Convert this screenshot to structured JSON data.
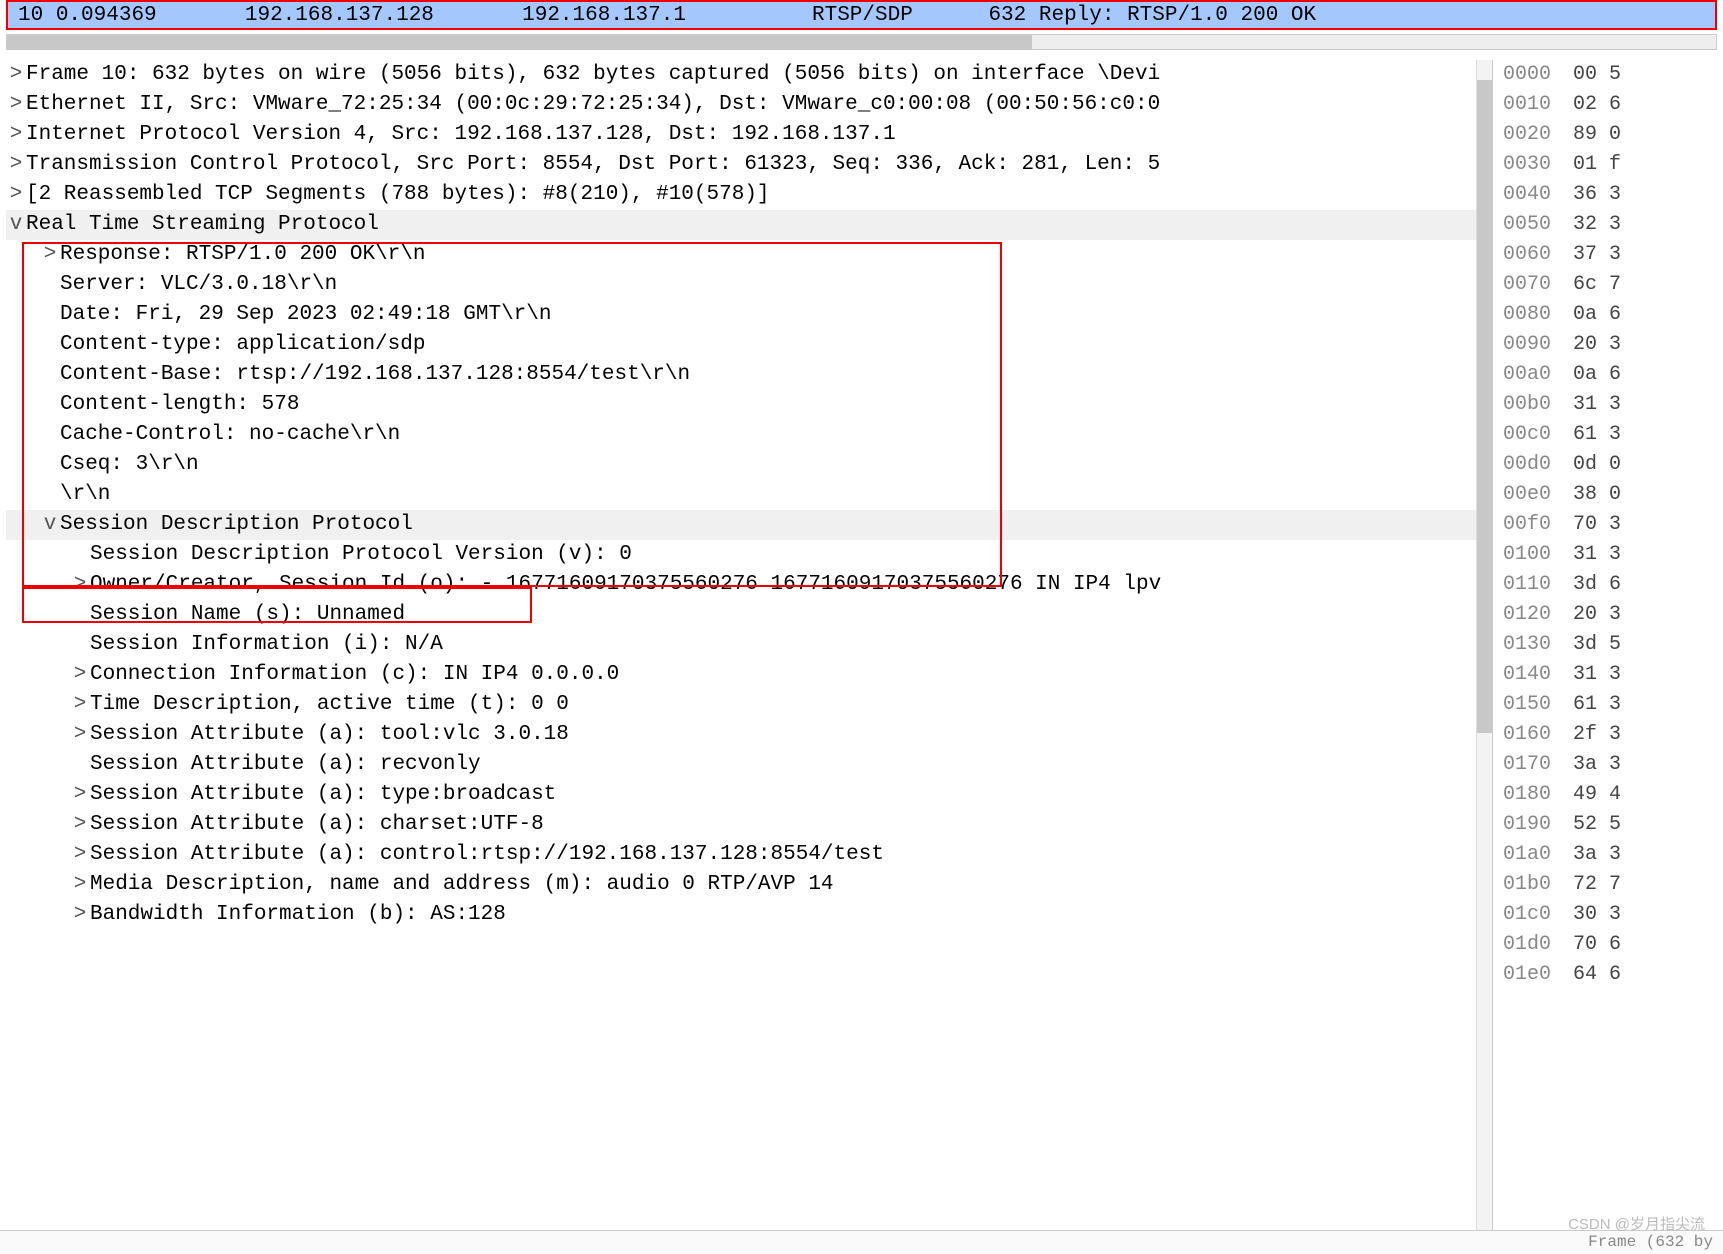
{
  "packet_row": {
    "no": "10",
    "time": "0.094369",
    "src": "192.168.137.128",
    "dst": "192.168.137.1",
    "proto": "RTSP/SDP",
    "len": "632",
    "info": "Reply: RTSP/1.0 200 OK"
  },
  "details": [
    {
      "tw": ">",
      "ind": 0,
      "dim": 0,
      "txt": "Frame 10: 632 bytes on wire (5056 bits), 632 bytes captured (5056 bits) on interface \\Devi"
    },
    {
      "tw": ">",
      "ind": 0,
      "dim": 0,
      "txt": "Ethernet II, Src: VMware_72:25:34 (00:0c:29:72:25:34), Dst: VMware_c0:00:08 (00:50:56:c0:0"
    },
    {
      "tw": ">",
      "ind": 0,
      "dim": 0,
      "txt": "Internet Protocol Version 4, Src: 192.168.137.128, Dst: 192.168.137.1"
    },
    {
      "tw": ">",
      "ind": 0,
      "dim": 0,
      "txt": "Transmission Control Protocol, Src Port: 8554, Dst Port: 61323, Seq: 336, Ack: 281, Len: 5"
    },
    {
      "tw": ">",
      "ind": 0,
      "dim": 0,
      "txt": "[2 Reassembled TCP Segments (788 bytes): #8(210), #10(578)]"
    },
    {
      "tw": "v",
      "ind": 0,
      "dim": 1,
      "txt": "Real Time Streaming Protocol"
    },
    {
      "tw": ">",
      "ind": 1,
      "dim": 0,
      "txt": "Response: RTSP/1.0 200 OK\\r\\n"
    },
    {
      "tw": "",
      "ind": 1,
      "dim": 0,
      "txt": "Server: VLC/3.0.18\\r\\n"
    },
    {
      "tw": "",
      "ind": 1,
      "dim": 0,
      "txt": "Date: Fri, 29 Sep 2023 02:49:18 GMT\\r\\n"
    },
    {
      "tw": "",
      "ind": 1,
      "dim": 0,
      "txt": "Content-type: application/sdp"
    },
    {
      "tw": "",
      "ind": 1,
      "dim": 0,
      "txt": "Content-Base: rtsp://192.168.137.128:8554/test\\r\\n"
    },
    {
      "tw": "",
      "ind": 1,
      "dim": 0,
      "txt": "Content-length: 578"
    },
    {
      "tw": "",
      "ind": 1,
      "dim": 0,
      "txt": "Cache-Control: no-cache\\r\\n"
    },
    {
      "tw": "",
      "ind": 1,
      "dim": 0,
      "txt": "Cseq: 3\\r\\n"
    },
    {
      "tw": "",
      "ind": 1,
      "dim": 0,
      "txt": "\\r\\n"
    },
    {
      "tw": "v",
      "ind": 1,
      "dim": 1,
      "txt": "Session Description Protocol"
    },
    {
      "tw": "",
      "ind": 2,
      "dim": 0,
      "txt": "Session Description Protocol Version (v): 0"
    },
    {
      "tw": ">",
      "ind": 2,
      "dim": 0,
      "txt": "Owner/Creator, Session Id (o): - 16771609170375560276 16771609170375560276 IN IP4 lpv"
    },
    {
      "tw": "",
      "ind": 2,
      "dim": 0,
      "txt": "Session Name (s): Unnamed"
    },
    {
      "tw": "",
      "ind": 2,
      "dim": 0,
      "txt": "Session Information (i): N/A"
    },
    {
      "tw": ">",
      "ind": 2,
      "dim": 0,
      "txt": "Connection Information (c): IN IP4 0.0.0.0"
    },
    {
      "tw": ">",
      "ind": 2,
      "dim": 0,
      "txt": "Time Description, active time (t): 0 0"
    },
    {
      "tw": ">",
      "ind": 2,
      "dim": 0,
      "txt": "Session Attribute (a): tool:vlc 3.0.18"
    },
    {
      "tw": "",
      "ind": 2,
      "dim": 0,
      "txt": "Session Attribute (a): recvonly"
    },
    {
      "tw": ">",
      "ind": 2,
      "dim": 0,
      "txt": "Session Attribute (a): type:broadcast"
    },
    {
      "tw": ">",
      "ind": 2,
      "dim": 0,
      "txt": "Session Attribute (a): charset:UTF-8"
    },
    {
      "tw": ">",
      "ind": 2,
      "dim": 0,
      "txt": "Session Attribute (a): control:rtsp://192.168.137.128:8554/test"
    },
    {
      "tw": ">",
      "ind": 2,
      "dim": 0,
      "txt": "Media Description, name and address (m): audio 0 RTP/AVP 14"
    },
    {
      "tw": ">",
      "ind": 2,
      "dim": 0,
      "txt": "Bandwidth Information (b): AS:128"
    }
  ],
  "hex": [
    {
      "off": "0000",
      "b": "00 5"
    },
    {
      "off": "0010",
      "b": "02 6"
    },
    {
      "off": "0020",
      "b": "89 0"
    },
    {
      "off": "0030",
      "b": "01 f"
    },
    {
      "off": "0040",
      "b": "36 3"
    },
    {
      "off": "0050",
      "b": "32 3"
    },
    {
      "off": "0060",
      "b": "37 3"
    },
    {
      "off": "0070",
      "b": "6c 7"
    },
    {
      "off": "0080",
      "b": "0a 6"
    },
    {
      "off": "0090",
      "b": "20 3"
    },
    {
      "off": "00a0",
      "b": "0a 6"
    },
    {
      "off": "00b0",
      "b": "31 3"
    },
    {
      "off": "00c0",
      "b": "61 3"
    },
    {
      "off": "00d0",
      "b": "0d 0"
    },
    {
      "off": "00e0",
      "b": "38 0"
    },
    {
      "off": "00f0",
      "b": "70 3"
    },
    {
      "off": "0100",
      "b": "31 3"
    },
    {
      "off": "0110",
      "b": "3d 6"
    },
    {
      "off": "0120",
      "b": "20 3"
    },
    {
      "off": "0130",
      "b": "3d 5"
    },
    {
      "off": "0140",
      "b": "31 3"
    },
    {
      "off": "0150",
      "b": "61 3"
    },
    {
      "off": "0160",
      "b": "2f 3"
    },
    {
      "off": "0170",
      "b": "3a 3"
    },
    {
      "off": "0180",
      "b": "49 4"
    },
    {
      "off": "0190",
      "b": "52 5"
    },
    {
      "off": "01a0",
      "b": "3a 3"
    },
    {
      "off": "01b0",
      "b": "72 7"
    },
    {
      "off": "01c0",
      "b": "30 3"
    },
    {
      "off": "01d0",
      "b": "70 6"
    },
    {
      "off": "01e0",
      "b": "64 6"
    }
  ],
  "statusbar": "Frame (632 by",
  "watermark": "CSDN @岁月指尖流"
}
